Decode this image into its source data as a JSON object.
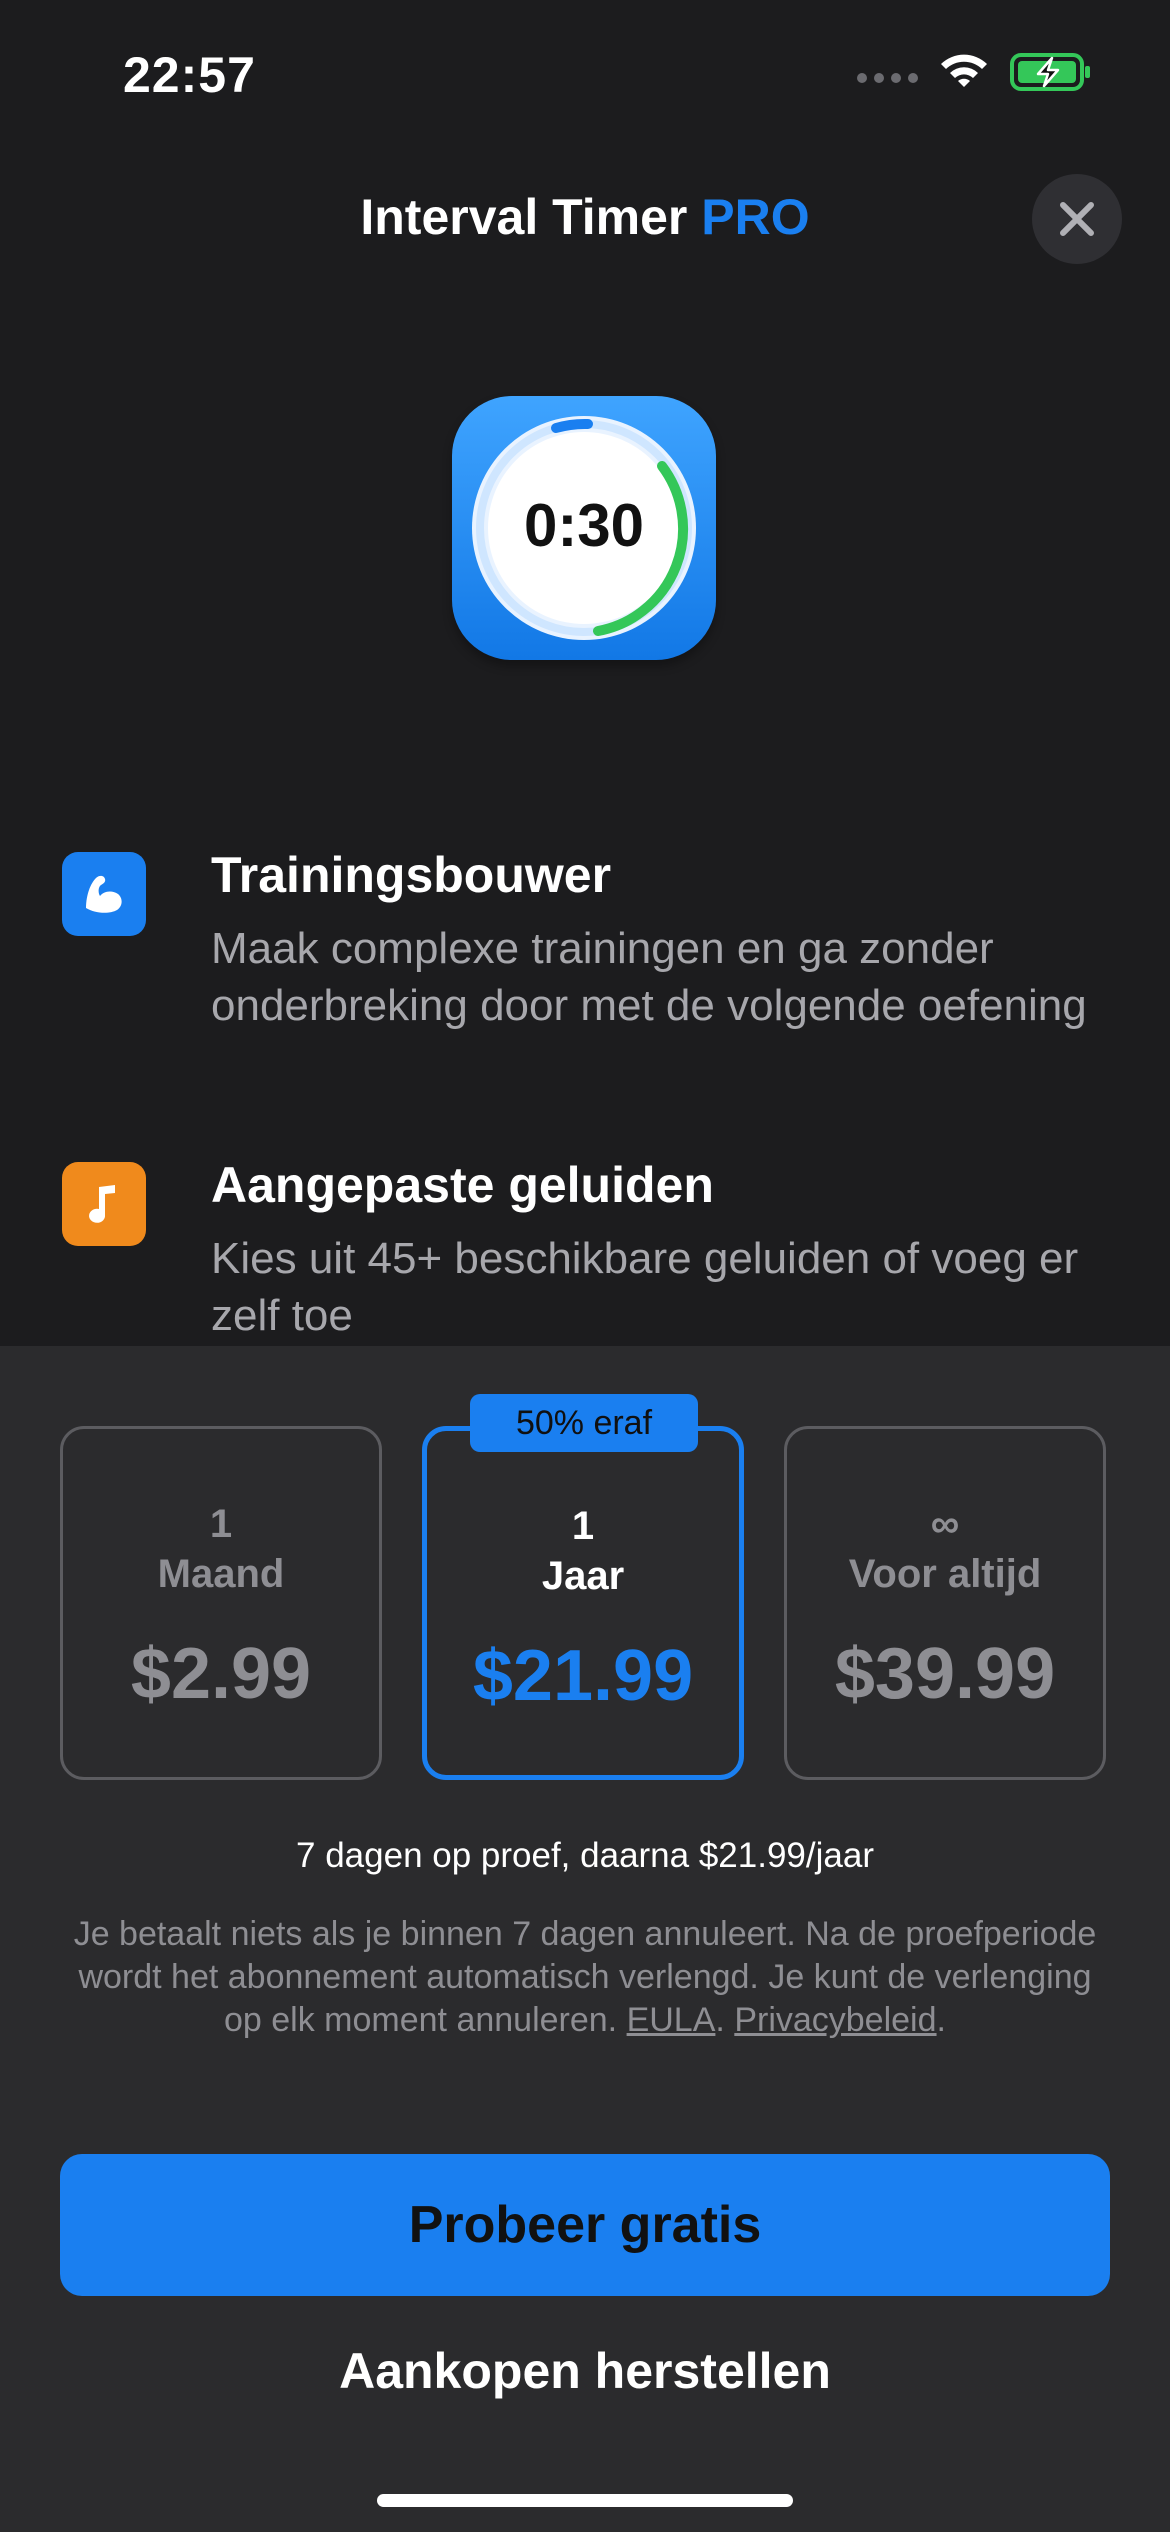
{
  "status_bar": {
    "time": "22:57"
  },
  "header": {
    "title": "Interval Timer",
    "title_accent": "PRO"
  },
  "app_icon": {
    "timer_text": "0:30"
  },
  "features": [
    {
      "icon": "flexed-biceps-icon",
      "title": "Trainingsbouwer",
      "description": "Maak complexe trainingen en ga zonder onderbreking door met de volgende oefening"
    },
    {
      "icon": "music-note-icon",
      "title": "Aangepaste geluiden",
      "description": "Kies uit 45+ beschikbare geluiden of voeg er zelf toe"
    }
  ],
  "plans": [
    {
      "qty": "1",
      "unit": "Maand",
      "price": "$2.99",
      "selected": false
    },
    {
      "qty": "1",
      "unit": "Jaar",
      "price": "$21.99",
      "selected": true,
      "badge": "50% eraf"
    },
    {
      "qty": "∞",
      "unit": "Voor altijd",
      "price": "$39.99",
      "selected": false
    }
  ],
  "trial_text": "7 dagen op proef, daarna $21.99/jaar",
  "legal": {
    "text": "Je betaalt niets als je binnen 7 dagen annuleert. Na de proefperiode wordt het abonnement automatisch verlengd. Je kunt de verlenging op elk moment annuleren.",
    "eula": "EULA",
    "privacy": "Privacybeleid"
  },
  "cta_label": "Probeer gratis",
  "restore_label": "Aankopen herstellen",
  "colors": {
    "accent": "#1a7ff0",
    "background": "#1c1c1e",
    "sheet": "#2b2b2d",
    "muscle_icon_bg": "#1a7ff0",
    "sound_icon_bg": "#f08a1c"
  }
}
